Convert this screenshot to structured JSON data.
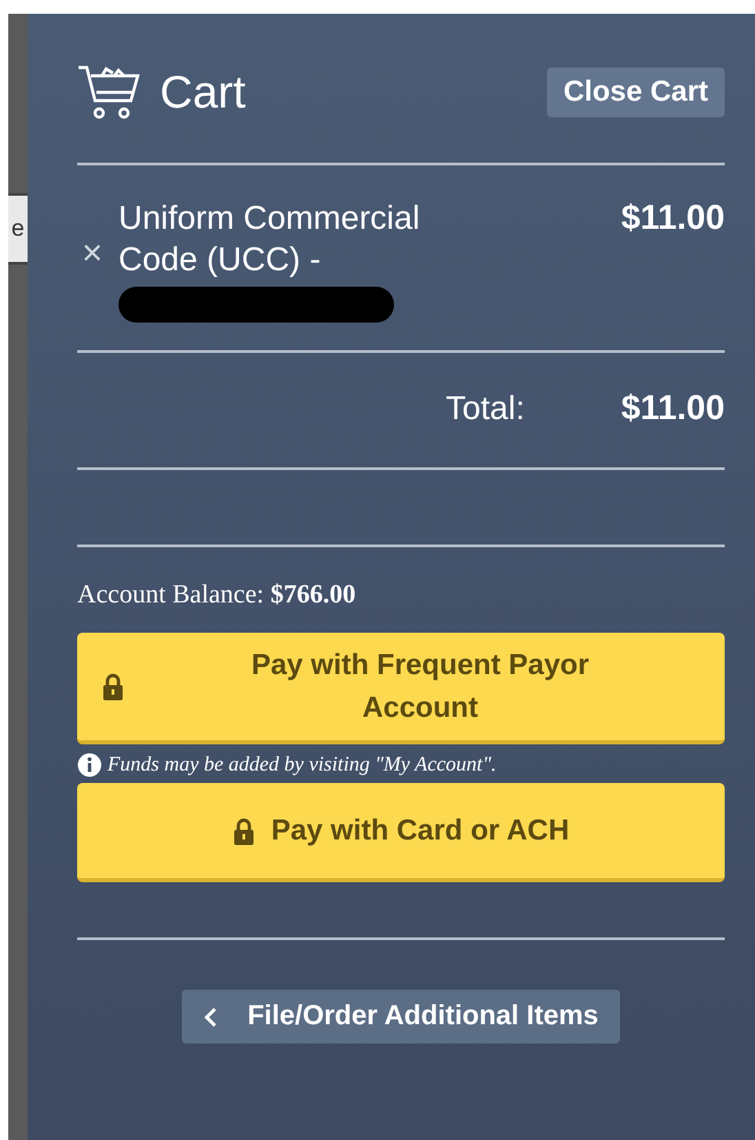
{
  "background": {
    "text": "e"
  },
  "cart": {
    "title": "Cart",
    "close_button": "Close Cart",
    "items": [
      {
        "remove": "×",
        "name": "Uniform Commercial Code (UCC) -",
        "price": "$11.00",
        "redacted": true
      }
    ],
    "total_label": "Total:",
    "total": "$11.00",
    "balance_label": "Account Balance:",
    "balance": "$766.00",
    "pay_buttons": [
      {
        "label": "Pay with Frequent Payor Account",
        "locked": true,
        "note": "Funds may be added by visiting \"My Account\"."
      },
      {
        "label": "Pay with Card or ACH",
        "locked": true
      }
    ],
    "back_button": "File/Order Additional Items"
  }
}
